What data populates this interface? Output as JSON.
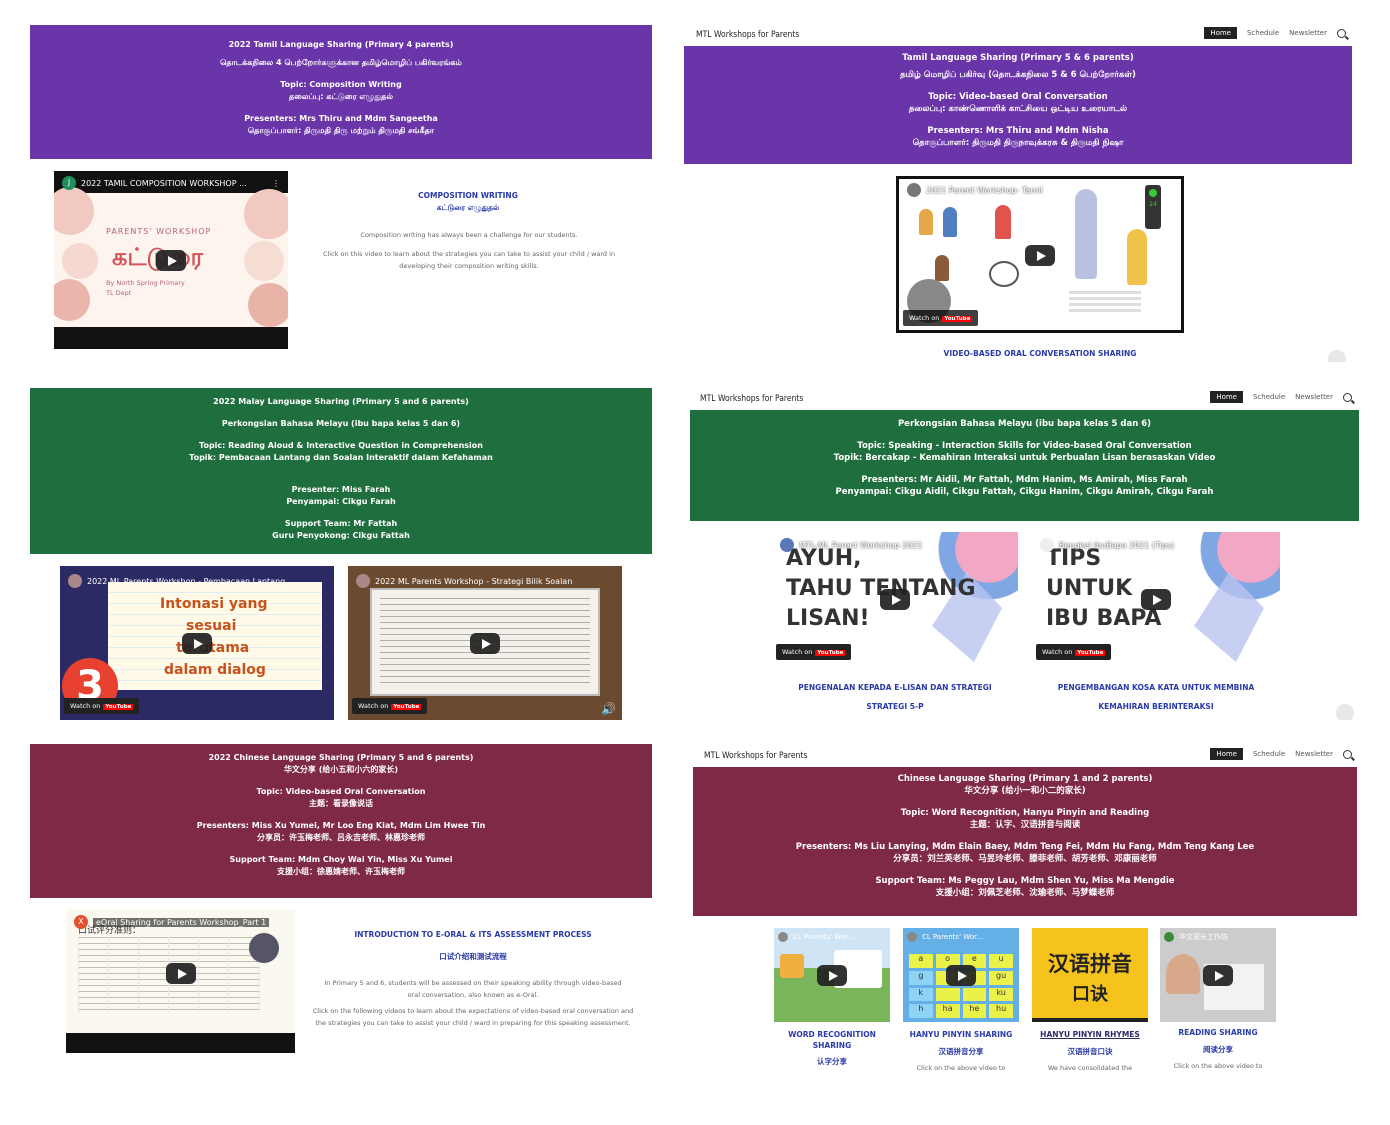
{
  "tamil_p4": {
    "banner_lines": [
      "2022 Tamil Language Sharing (Primary 4 parents)",
      "தொடக்கநிலை 4 பெற்றோர்களுக்கான தமிழ்மொழிப் பகிர்வரங்கம்",
      "",
      "Topic: Composition Writing",
      "தலைப்பு: கட்டுரை எழுதுதல்",
      "",
      "Presenters: Mrs Thiru and Mdm Sangeetha",
      "தொகுப்பாளர்: திருமதி திரு மற்றும் திருமதி சங்கீதா"
    ],
    "video": {
      "title": "2022 TAMIL COMPOSITION WORKSHOP ...",
      "channel_initial": "J",
      "art_line1": "PARENTS' WORKSHOP",
      "art_word": "கட்டுரை",
      "art_line3": "By North Spring Primary",
      "art_line4": "TL Dept"
    },
    "side_title": "COMPOSITION WRITING",
    "side_title2": "கட்டுரை எழுதுதல்",
    "side_desc1": "Composition writing has always been a challenge for our students.",
    "side_desc2": "Click on this video to learn about the strategies you can take to assist your child / ward in developing their composition writing skills."
  },
  "tamil_p56": {
    "nav": {
      "brand": "MTL Workshops for Parents",
      "home": "Home",
      "schedule": "Schedule",
      "newsletter": "Newsletter"
    },
    "banner_lines": [
      "Tamil Language Sharing (Primary 5 & 6 parents)",
      "தமிழ் மொழிப் பகிர்வு (தொடக்கநிலை 5 & 6 பெற்றோர்கள்)",
      "",
      "Topic: Video-based Oral Conversation",
      "தலைப்பு: காண்ணொளிக் காட்சியை ஒட்டிய உரையாடல்",
      "",
      "Presenters: Mrs Thiru and Mdm Nisha",
      "தொகுப்பாளர்: திருமதி திருநாவுக்கரசு & திருமதி நிஷா"
    ],
    "video": {
      "title": "2021 Parent Workshop- Tamil",
      "watch_on": "Watch on",
      "yt": "YouTube",
      "signal": "24"
    },
    "caption": "VIDEO-BASED ORAL CONVERSATION SHARING"
  },
  "malay_p56": {
    "banner_lines": [
      "2022 Malay Language Sharing (Primary 5 and 6 parents)",
      "",
      "Perkongsian Bahasa Melayu (ibu bapa kelas 5 dan 6)",
      "",
      "Topic:  Reading Aloud & Interactive Question in Comprehension",
      "Topik: Pembacaan Lantang dan Soalan Interaktif dalam Kefahaman",
      "",
      "",
      "Presenter: Miss Farah",
      "Penyampai: Cikgu Farah",
      "",
      "Support Team: Mr Fattah",
      "Guru Penyokong: Cikgu Fattah"
    ],
    "video1": {
      "title": "2022 ML Parents Workshop - Pembacaan Lantang",
      "art": [
        "Intonasi yang",
        "sesuai",
        "terutama",
        "dalam dialog"
      ],
      "badge": "3",
      "watch_on": "Watch on",
      "yt": "YouTube"
    },
    "video2": {
      "title": "2022 ML Parents Workshop - Strategi Bilik Soalan",
      "watch_on": "Watch on",
      "yt": "YouTube"
    }
  },
  "malay_p56b": {
    "nav": {
      "brand": "MTL Workshops for Parents",
      "home": "Home",
      "schedule": "Schedule",
      "newsletter": "Newsletter"
    },
    "banner_lines": [
      "Perkongsian Bahasa Melayu (ibu bapa kelas 5 dan 6)",
      "",
      "Topic:  Speaking - Interaction Skills for Video-based Oral Conversation",
      "Topik:  Bercakap - Kemahiran Interaksi untuk Perbualan Lisan berasaskan Video",
      "",
      "Presenters: Mr Aidil, Mr Fattah, Mdm Hanim, Ms Amirah, Miss Farah",
      "Penyampai: Cikgu Aidil, Cikgu Fattah, Cikgu Hanim, Cikgu Amirah, Cikgu Farah"
    ],
    "video1": {
      "title": "MTL-ML Parent Workshop 2021",
      "art": [
        "AYUH,",
        "TAHU TENTANG",
        "LISAN!"
      ],
      "watch_on": "Watch on",
      "yt": "YouTube"
    },
    "video2": {
      "title": "Bengkel IbuBapa 2021 (Tips)",
      "art": [
        "TIPS",
        "UNTUK",
        "IBU BAPA"
      ],
      "watch_on": "Watch on",
      "yt": "YouTube"
    },
    "caption1a": "PENGENALAN KEPADA E-LISAN DAN STRATEGI",
    "caption1b": "STRATEGI 5-P",
    "caption2a": "PENGEMBANGAN KOSA  KATA UNTUK MEMBINA",
    "caption2b": "KEMAHIRAN BERINTERAKSI"
  },
  "chinese_p56": {
    "banner_lines": [
      "2022 Chinese Language Sharing (Primary 5 and 6 parents)",
      "华文分享 (给小五和小六的家长)",
      "",
      "Topic:  Video-based Oral Conversation",
      "主题：看录像说话",
      "",
      "Presenters: Miss Xu Yumei, Mr Loo Eng Kiat, Mdm Lim Hwee Tin",
      "分享员：许玉梅老师、吕永吉老师、林惠珍老师",
      "",
      "Support Team: Mdm Choy Wai Yin, Miss Xu Yumei",
      "支援小组：徐惠婧老师、许玉梅老师"
    ],
    "video": {
      "title": "eOral Sharing for Parents Workshop_Part 1",
      "channel_initial": "X",
      "subtitle": "口试评分准则："
    },
    "side_title": "INTRODUCTION TO E-ORAL & ITS ASSESSMENT PROCESS",
    "side_title2": "口试介绍和测试流程",
    "side_desc1": "In Primary 5 and 6, students will be assessed on their speaking ability through video-based oral conversation, also known as e-Oral.",
    "side_desc2": "Click on the following videos to learn about the expectations of video-based oral conversation and the strategies you can take to assist your child / ward in preparing for this speaking assessment."
  },
  "chinese_p12": {
    "nav": {
      "brand": "MTL Workshops for Parents",
      "home": "Home",
      "schedule": "Schedule",
      "newsletter": "Newsletter"
    },
    "banner_lines": [
      "Chinese Language Sharing   (Primary 1 and 2 parents)",
      "华文分享   (给小一和小二的家长)",
      "",
      "Topic:   Word Recognition, Hanyu Pinyin and Reading",
      "主题：认字、汉语拼音与阅读",
      "",
      "Presenters: Ms Liu Lanying, Mdm Elain Baey, Mdm Teng Fei, Mdm Hu Fang, Mdm Teng Kang Lee",
      "分享员：刘兰英老师、马昱玲老师、滕菲老师、胡芳老师、邓康丽老师",
      "",
      "Support Team: Ms Peggy Lau, Mdm Shen Yu, Miss Ma Mengdie",
      "支援小组：刘佩芝老师、沈瑜老师、马梦蝶老师"
    ],
    "videos": [
      {
        "title": "CL Parents' Wor...",
        "cap1": "WORD RECOGNITION",
        "cap2": "SHARING",
        "cap3": "认字分享",
        "desc": ""
      },
      {
        "title": "CL Parents' Wor...",
        "cap1": "HANYU PINYIN SHARING",
        "cap2": "汉语拼音分享",
        "cap3": "",
        "desc": "Click on the above video to"
      },
      {
        "title": "",
        "cap1": "HANYU PINYIN RHYMES",
        "cap2": "汉语拼音口诀",
        "cap3": "",
        "desc": "We have consolidated the"
      },
      {
        "title": "华文家长工作坊",
        "cap1": "READING SHARING",
        "cap2": "阅读分享",
        "cap3": "",
        "desc": "Click on the above video to"
      }
    ],
    "pinyin_art": [
      "汉语拼音",
      "口诀"
    ],
    "pinyin_cells": [
      "a",
      "o",
      "e",
      "u",
      "g",
      "gu",
      "k",
      "ku",
      "h",
      "ha",
      "he",
      "hu"
    ]
  },
  "colors": {
    "purple": "#6a35a8",
    "green": "#1f6e3e",
    "maroon": "#7f2a44",
    "link_blue": "#2a3aa8",
    "pinyin_yellow": "#f6c21c"
  }
}
